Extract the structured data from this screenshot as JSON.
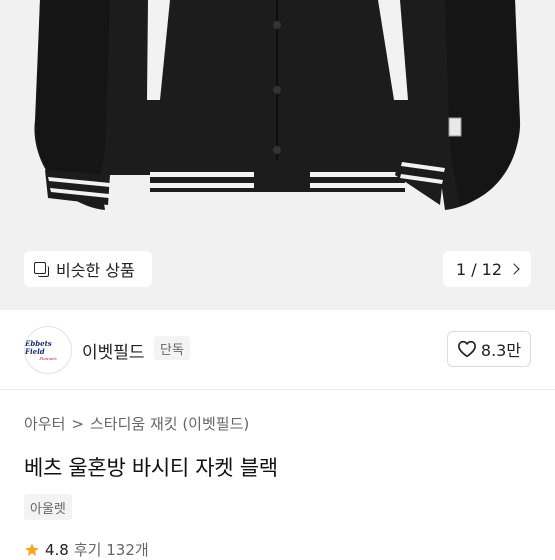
{
  "gallery": {
    "similar_label": "비슷한 상품",
    "pager_text": "1 / 12"
  },
  "brand": {
    "logo_line1": "Ebbets Field",
    "logo_line2": "Flannels",
    "name": "이벳필드",
    "tag": "단독",
    "likes": "8.3만"
  },
  "product": {
    "breadcrumb": [
      "아우터",
      "스타디움 재킷 (이벳필드)"
    ],
    "breadcrumb_sep": ">",
    "title": "베츠 울혼방 바시티 자켓 블랙",
    "chip": "아울렛"
  },
  "rating": {
    "score": "4.8",
    "review_text": "후기 132개"
  },
  "colors": {
    "hero_bg": "#f1f1f1",
    "jacket": "#1b1b1b",
    "star": "#f5a623"
  }
}
